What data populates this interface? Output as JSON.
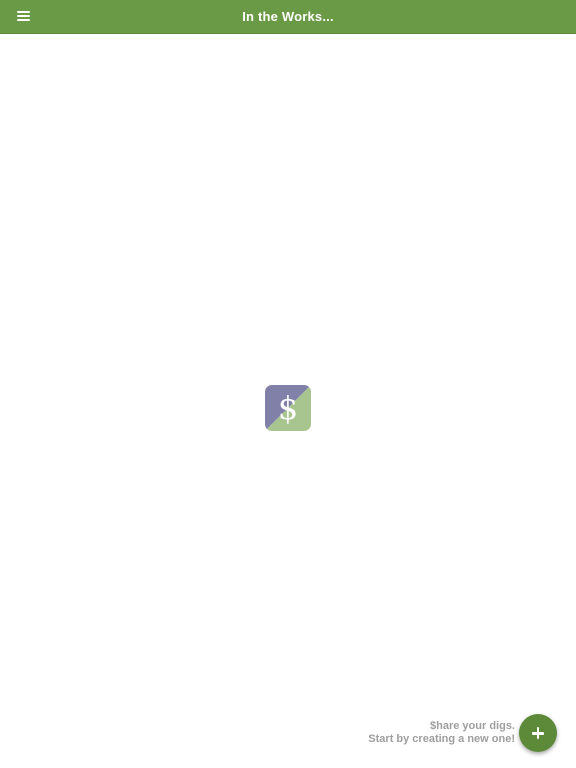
{
  "header": {
    "title": "In the Works..."
  },
  "logo": {
    "symbol": "$",
    "colors": {
      "top_left": "#8180a8",
      "bottom_right": "#a9c58f",
      "glyph": "#ffffff"
    }
  },
  "empty_state": {
    "line1": "$hare your digs.",
    "line2": "Start by creating a new one!"
  },
  "colors": {
    "header_background": "#6a9a45",
    "fab_background": "#5c8a38",
    "message_text": "#9e9e9e"
  },
  "icons": {
    "menu": "hamburger-menu-icon",
    "fab": "plus-icon"
  }
}
